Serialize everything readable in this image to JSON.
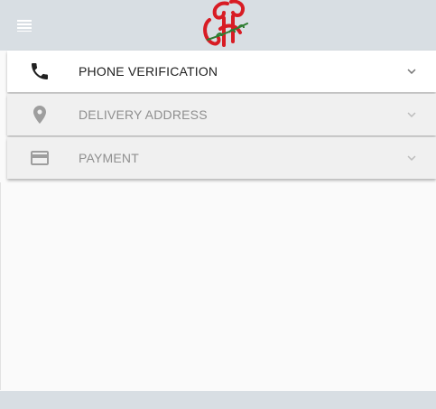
{
  "header": {
    "menu_icon": "menu-icon",
    "logo_icon": "brand-logo",
    "colors": {
      "bar": "#d8dee3",
      "logo_red": "#d81c24",
      "logo_green": "#2e7d32"
    }
  },
  "steps": [
    {
      "label": "PHONE VERIFICATION",
      "icon": "phone-icon",
      "state": "active"
    },
    {
      "label": "DELIVERY ADDRESS",
      "icon": "location-pin-icon",
      "state": "disabled"
    },
    {
      "label": "PAYMENT",
      "icon": "credit-card-icon",
      "state": "disabled"
    }
  ]
}
